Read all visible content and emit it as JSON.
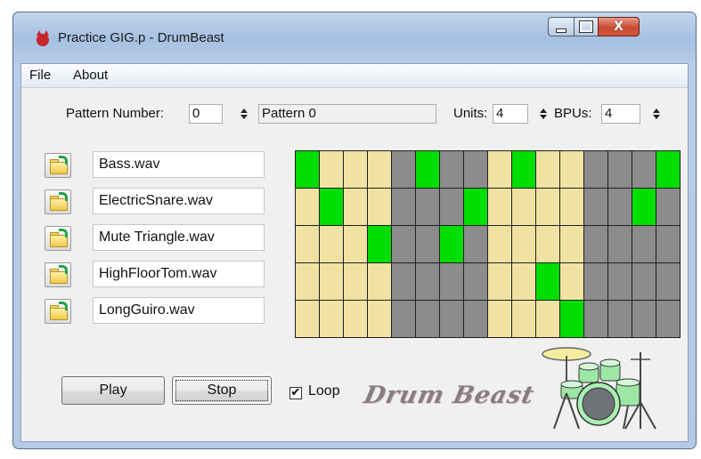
{
  "window": {
    "title": "Practice GIG.p - DrumBeast",
    "minimize_icon": "minimize-icon",
    "maximize_icon": "maximize-icon",
    "close_glyph": "X"
  },
  "menu": {
    "items": [
      "File",
      "About"
    ]
  },
  "pattern": {
    "number_label": "Pattern Number:",
    "number_value": "0",
    "name_value": "Pattern 0",
    "units_label": "Units:",
    "units_value": "4",
    "bpus_label": "BPUs:",
    "bpus_value": "4"
  },
  "tracks": [
    {
      "file": "Bass.wav",
      "steps": [
        1,
        0,
        0,
        0,
        0,
        1,
        0,
        0,
        0,
        1,
        0,
        0,
        0,
        0,
        0,
        1
      ]
    },
    {
      "file": "ElectricSnare.wav",
      "steps": [
        0,
        1,
        0,
        0,
        0,
        0,
        0,
        1,
        0,
        0,
        0,
        0,
        0,
        0,
        1,
        0
      ]
    },
    {
      "file": "Mute Triangle.wav",
      "steps": [
        0,
        0,
        0,
        1,
        0,
        0,
        1,
        0,
        0,
        0,
        0,
        0,
        0,
        0,
        0,
        0
      ]
    },
    {
      "file": "HighFloorTom.wav",
      "steps": [
        0,
        0,
        0,
        0,
        0,
        0,
        0,
        0,
        0,
        0,
        1,
        0,
        0,
        0,
        0,
        0
      ]
    },
    {
      "file": "LongGuiro.wav",
      "steps": [
        0,
        0,
        0,
        0,
        0,
        0,
        0,
        0,
        0,
        0,
        0,
        1,
        0,
        0,
        0,
        0
      ]
    }
  ],
  "grid": {
    "steps_per_row": 16,
    "unit_size": 4,
    "colors": {
      "active": "#00dd00",
      "beat_on": "#f0e2a2",
      "beat_off": "#8c8c8c"
    }
  },
  "controls": {
    "play_label": "Play",
    "stop_label": "Stop",
    "loop_label": "Loop",
    "loop_checked": true,
    "loop_check_glyph": "✔"
  },
  "logo": {
    "text": "Drum Beast",
    "image_icon": "drum-kit-icon"
  }
}
